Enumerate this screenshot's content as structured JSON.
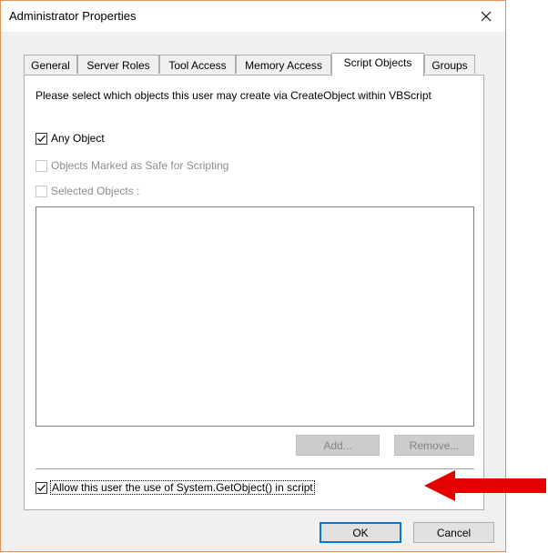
{
  "window": {
    "title": "Administrator Properties",
    "close_glyph": "✕"
  },
  "tabs": [
    {
      "label": "General",
      "active": false
    },
    {
      "label": "Server Roles",
      "active": false
    },
    {
      "label": "Tool Access",
      "active": false
    },
    {
      "label": "Memory Access",
      "active": false
    },
    {
      "label": "Script Objects",
      "active": true
    },
    {
      "label": "Groups",
      "active": false
    }
  ],
  "script_objects": {
    "description": "Please select which objects this user may create via CreateObject within VBScript",
    "any_object": {
      "label": "Any Object",
      "checked": true,
      "enabled": true
    },
    "safe_objects": {
      "label": "Objects Marked as Safe for Scripting",
      "checked": false,
      "enabled": false
    },
    "selected_objects": {
      "label": "Selected Objects :",
      "checked": false,
      "enabled": false
    },
    "objects_list": [],
    "add_button": "Add...",
    "remove_button": "Remove...",
    "allow_getobject": {
      "label": "Allow this user the use of System.GetObject() in script",
      "checked": true,
      "enabled": true
    }
  },
  "footer": {
    "ok_button": "OK",
    "cancel_button": "Cancel"
  },
  "colors": {
    "annotation_arrow": "#e50000",
    "dialog_border": "#e39356",
    "default_button_border": "#0078d7"
  }
}
